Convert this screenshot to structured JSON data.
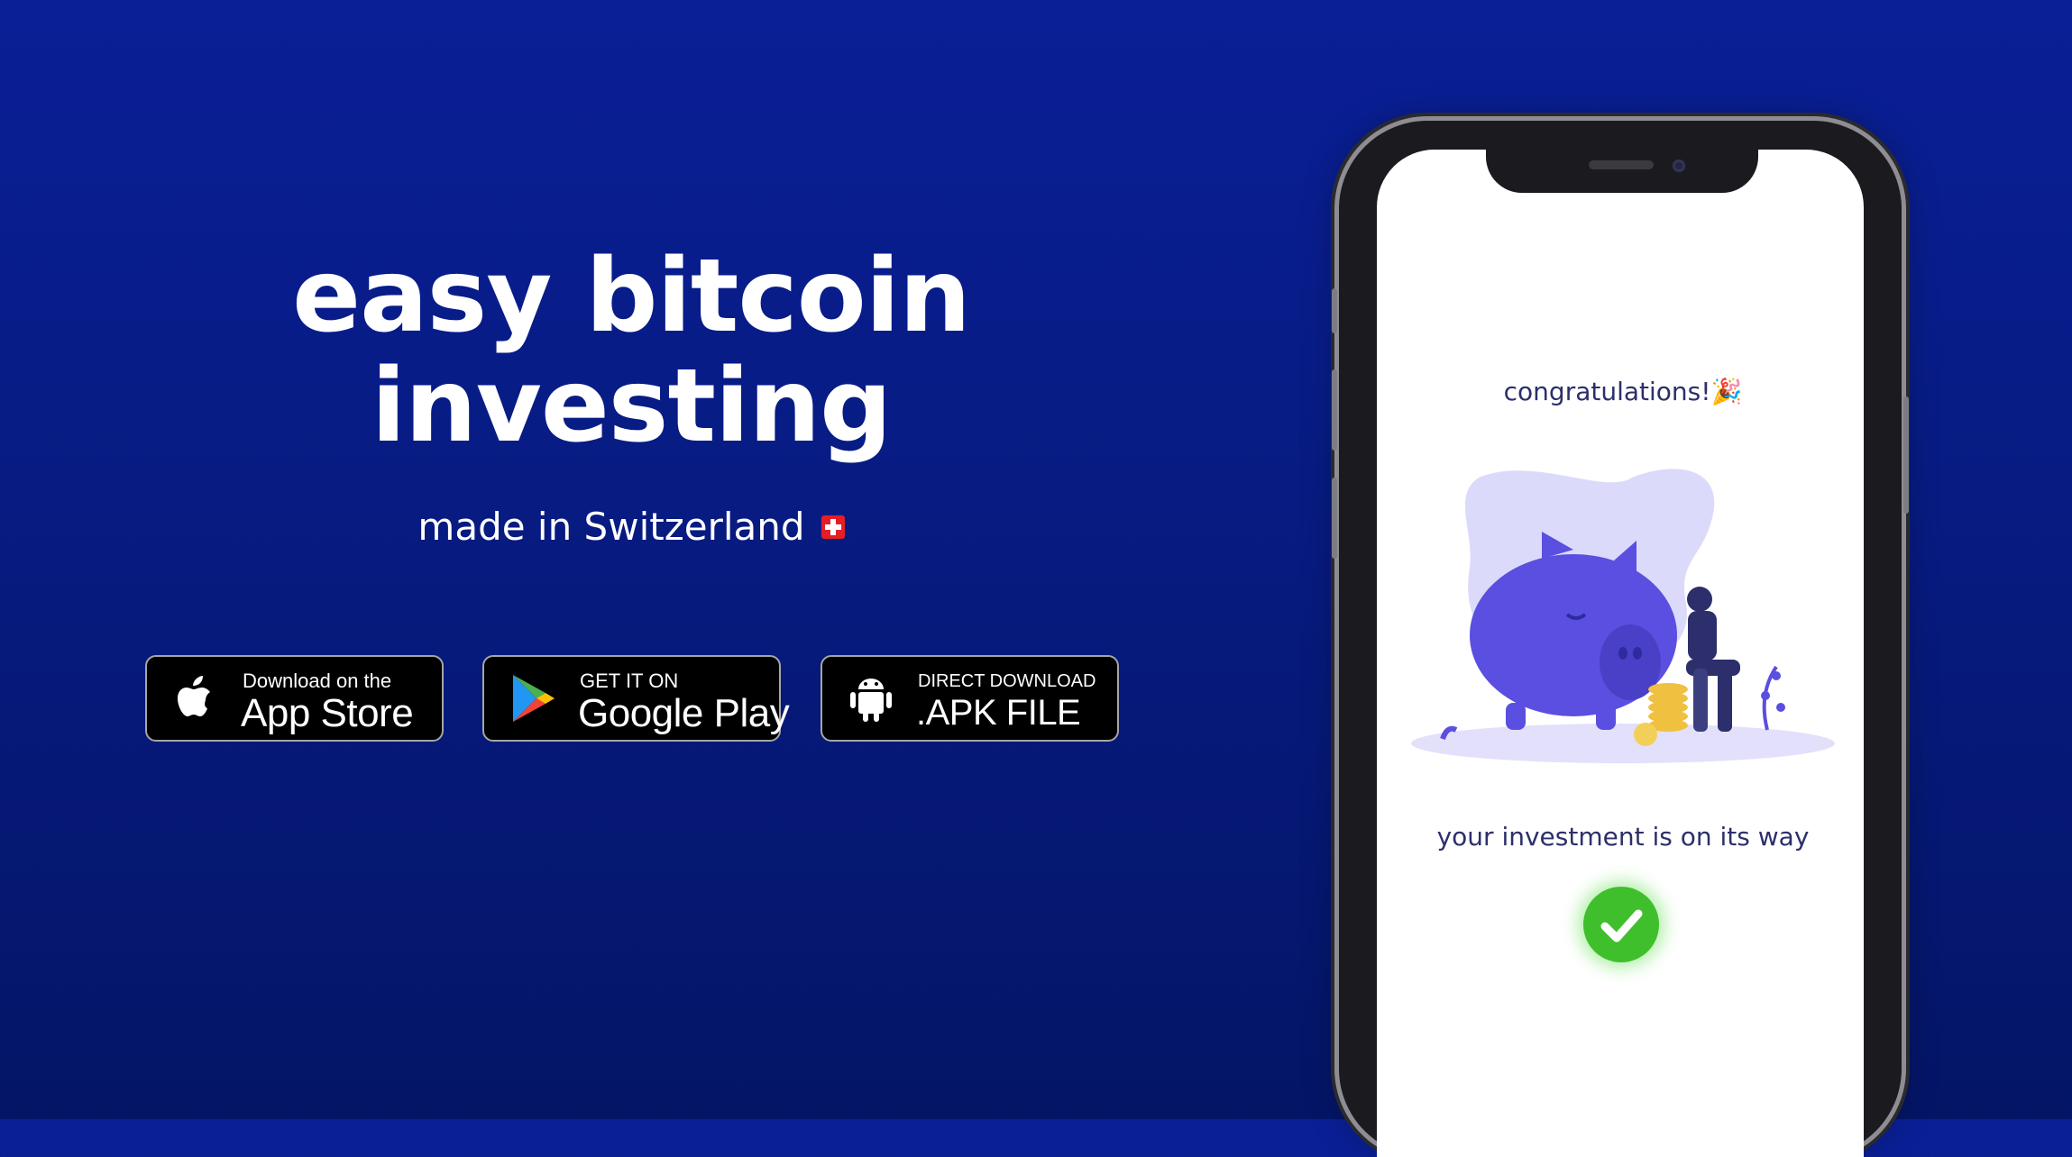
{
  "hero": {
    "headline_line1": "easy bitcoin",
    "headline_line2": "investing",
    "subline": "made in Switzerland"
  },
  "download_buttons": [
    {
      "line1": "Download on the",
      "line2": "App Store",
      "icon": "apple-icon"
    },
    {
      "line1": "GET IT ON",
      "line2": "Google Play",
      "icon": "google-play-icon"
    },
    {
      "line1": "DIRECT DOWNLOAD",
      "line2": ".APK FILE",
      "icon": "android-icon"
    }
  ],
  "phone_screen": {
    "congrats_text": "congratulations!🎉",
    "status_text": "your investment is on its way",
    "status_icon": "checkmark-icon"
  },
  "colors": {
    "background": "#0a1f96",
    "accent_purple": "#5a4fe0",
    "success_green": "#3fbf2c"
  }
}
